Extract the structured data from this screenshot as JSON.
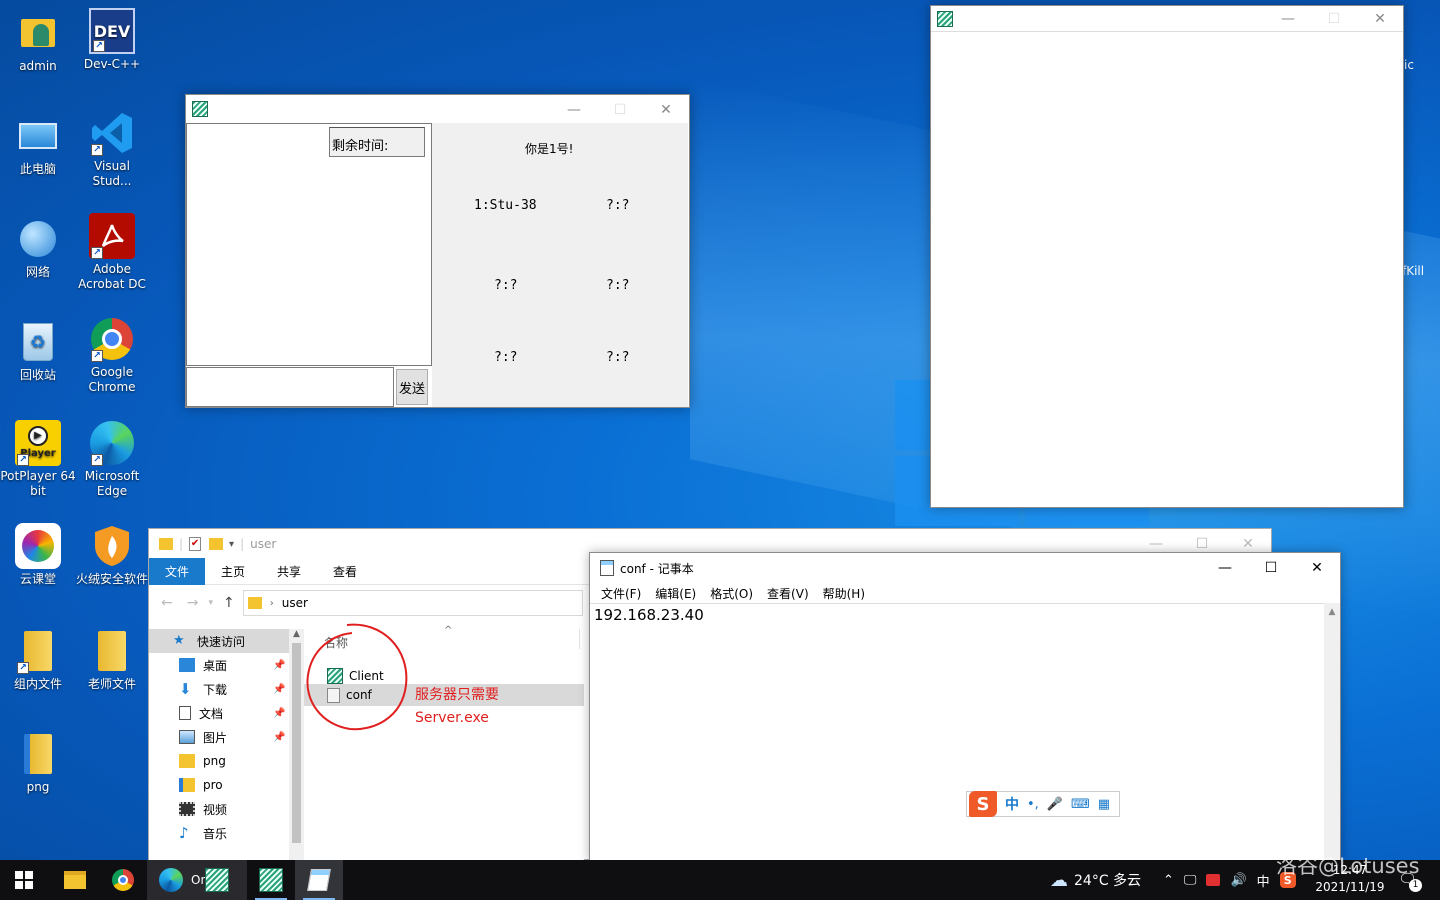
{
  "desktop": {
    "icons": [
      {
        "label": "admin"
      },
      {
        "label": "Dev-C++",
        "badge": "DEV"
      },
      {
        "label": "此电脑"
      },
      {
        "label": "Visual Stud..."
      },
      {
        "label": "网络"
      },
      {
        "label": "Adobe Acrobat DC"
      },
      {
        "label": "回收站"
      },
      {
        "label": "Google Chrome"
      },
      {
        "label": "PotPlayer 64 bit",
        "badge": "Player"
      },
      {
        "label": "Microsoft Edge"
      },
      {
        "label": "云课堂"
      },
      {
        "label": "火绒安全软件"
      },
      {
        "label": "组内文件"
      },
      {
        "label": "老师文件"
      },
      {
        "label": "png"
      }
    ],
    "edge_text_1": "ic",
    "edge_text_2": "fKill"
  },
  "client": {
    "remaining_label": "剩余时间:",
    "you_are": "你是1号!",
    "slots": [
      "1:Stu-38",
      "?:?",
      "?:?",
      "?:?",
      "?:?",
      "?:?"
    ],
    "send_label": "发送"
  },
  "explorer": {
    "title": "user",
    "ribbon": [
      "文件",
      "主页",
      "共享",
      "查看"
    ],
    "breadcrumb": "user",
    "column_name": "名称",
    "files": [
      "Client",
      "conf"
    ],
    "nav": [
      {
        "label": "快速访问"
      },
      {
        "label": "桌面"
      },
      {
        "label": "下载"
      },
      {
        "label": "文档"
      },
      {
        "label": "图片"
      },
      {
        "label": "png"
      },
      {
        "label": "pro"
      },
      {
        "label": "视频"
      },
      {
        "label": "音乐"
      }
    ],
    "annotation_1": "服务器只需要",
    "annotation_2": "Server.exe"
  },
  "notepad": {
    "title": "conf - 记事本",
    "menu": [
      "文件(F)",
      "编辑(E)",
      "格式(O)",
      "查看(V)",
      "帮助(H)"
    ],
    "content": "192.168.23.40"
  },
  "ime": {
    "mode": "中"
  },
  "taskbar": {
    "weather": "24°C 多云",
    "lang": "中",
    "time": "12:47",
    "date": "2021/11/19",
    "notif_count": "1",
    "watermark": "洛谷@Lotuses",
    "partial_label": "On   ve"
  },
  "colors": {
    "accent": "#1979ca",
    "annotation": "#e02020"
  }
}
